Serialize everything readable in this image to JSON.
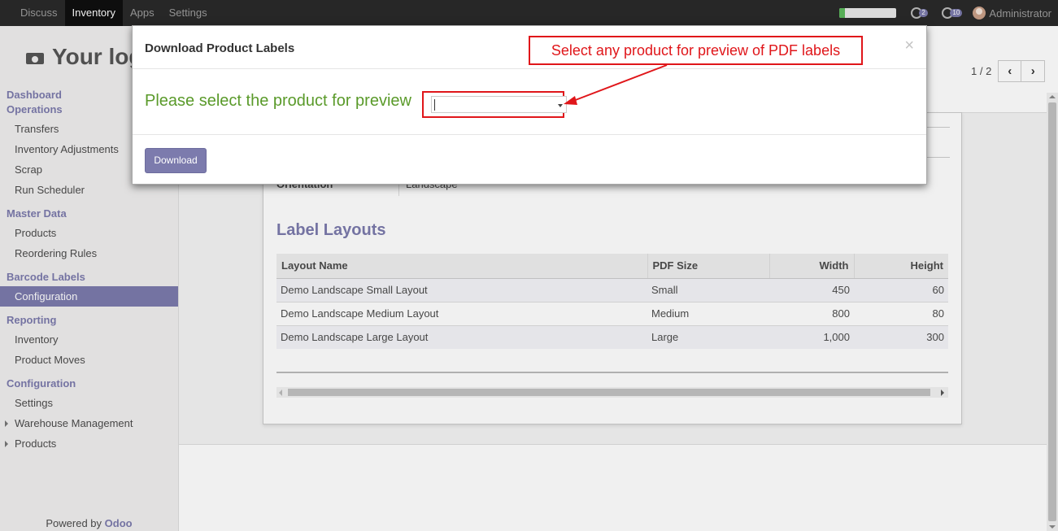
{
  "topbar": {
    "menu": [
      "Discuss",
      "Inventory",
      "Apps",
      "Settings"
    ],
    "progress_fraction": 0.1,
    "notif_badge": "2",
    "message_badge": "10",
    "user_name": "Administrator",
    "icons": [
      "progress-bar",
      "conversations-icon",
      "messages-icon",
      "avatar"
    ]
  },
  "sidebar": {
    "logo_text": "Your log",
    "sections": [
      {
        "head": "Dashboard",
        "items": []
      },
      {
        "head": "Operations",
        "items": [
          "Transfers",
          "Inventory Adjustments",
          "Scrap",
          "Run Scheduler"
        ]
      },
      {
        "head": "Master Data",
        "items": [
          "Products",
          "Reordering Rules"
        ]
      },
      {
        "head": "Barcode Labels",
        "items": [
          "Configuration"
        ]
      },
      {
        "head": "Reporting",
        "items": [
          "Inventory",
          "Product Moves"
        ]
      },
      {
        "head": "Configuration",
        "items": [
          "Settings",
          "Warehouse Management",
          "Products"
        ]
      }
    ],
    "active_item": "Configuration",
    "powered_prefix": "Powered by ",
    "powered_brand": "Odoo"
  },
  "pager": {
    "value": "1 / 2",
    "prev": "‹",
    "next": "›"
  },
  "sheet": {
    "field_label": "Orientation",
    "field_value": "Landscape",
    "section_title": "Label Layouts",
    "columns": [
      "Layout Name",
      "PDF Size",
      "Width",
      "Height"
    ],
    "rows": [
      [
        "Demo Landscape Small Layout",
        "Small",
        "450",
        "60"
      ],
      [
        "Demo Landscape Medium Layout",
        "Medium",
        "800",
        "80"
      ],
      [
        "Demo Landscape Large Layout",
        "Large",
        "1,000",
        "300"
      ]
    ]
  },
  "modal": {
    "title": "Download Product Labels",
    "close": "×",
    "prompt": "Please select the product for preview",
    "select_value": "",
    "download_label": "Download"
  },
  "annotation": {
    "text": "Select any product for preview of PDF labels"
  },
  "colors": {
    "brand": "#7c7bad",
    "annotation": "#e0161a",
    "prompt": "#5a9a2a",
    "topbar": "#2a2a2a"
  }
}
